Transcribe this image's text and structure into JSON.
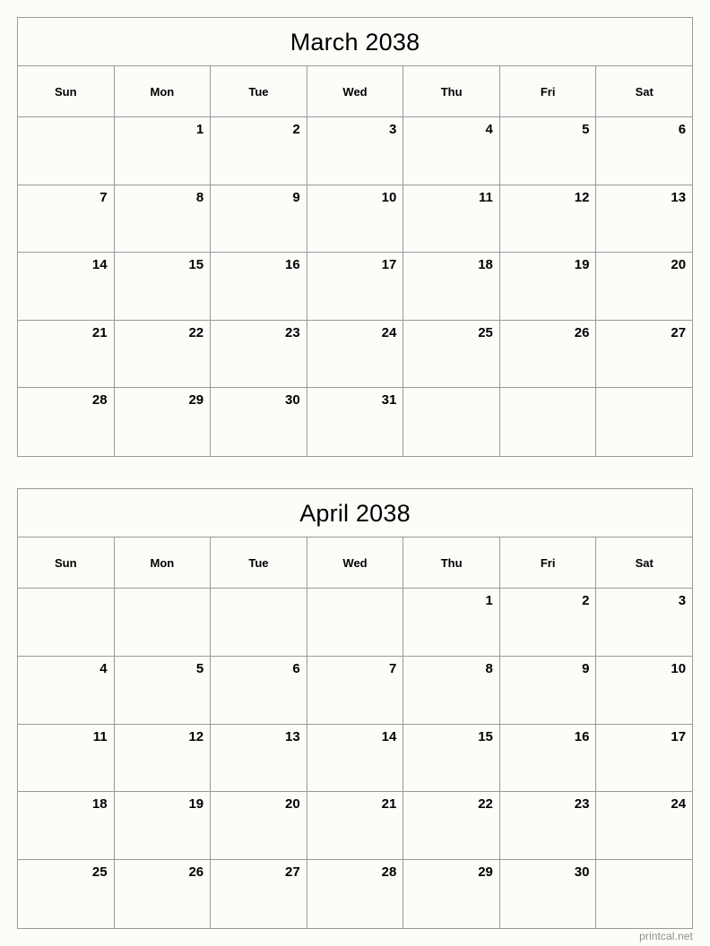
{
  "page": {
    "background_color": "#fbfdf9",
    "border_color": "#9a9a9a",
    "text_color": "#000000"
  },
  "footer": {
    "watermark": "printcal.net",
    "color": "#8d8d8d"
  },
  "weekday_headers": [
    "Sun",
    "Mon",
    "Tue",
    "Wed",
    "Thu",
    "Fri",
    "Sat"
  ],
  "calendars": [
    {
      "title": "March 2038",
      "month": "March",
      "year": "2038",
      "days_in_month": 31,
      "first_day_index": 1,
      "weeks": [
        [
          "",
          "1",
          "2",
          "3",
          "4",
          "5",
          "6"
        ],
        [
          "7",
          "8",
          "9",
          "10",
          "11",
          "12",
          "13"
        ],
        [
          "14",
          "15",
          "16",
          "17",
          "18",
          "19",
          "20"
        ],
        [
          "21",
          "22",
          "23",
          "24",
          "25",
          "26",
          "27"
        ],
        [
          "28",
          "29",
          "30",
          "31",
          "",
          "",
          ""
        ]
      ]
    },
    {
      "title": "April 2038",
      "month": "April",
      "year": "2038",
      "days_in_month": 30,
      "first_day_index": 4,
      "weeks": [
        [
          "",
          "",
          "",
          "",
          "1",
          "2",
          "3"
        ],
        [
          "4",
          "5",
          "6",
          "7",
          "8",
          "9",
          "10"
        ],
        [
          "11",
          "12",
          "13",
          "14",
          "15",
          "16",
          "17"
        ],
        [
          "18",
          "19",
          "20",
          "21",
          "22",
          "23",
          "24"
        ],
        [
          "25",
          "26",
          "27",
          "28",
          "29",
          "30",
          ""
        ]
      ]
    }
  ]
}
